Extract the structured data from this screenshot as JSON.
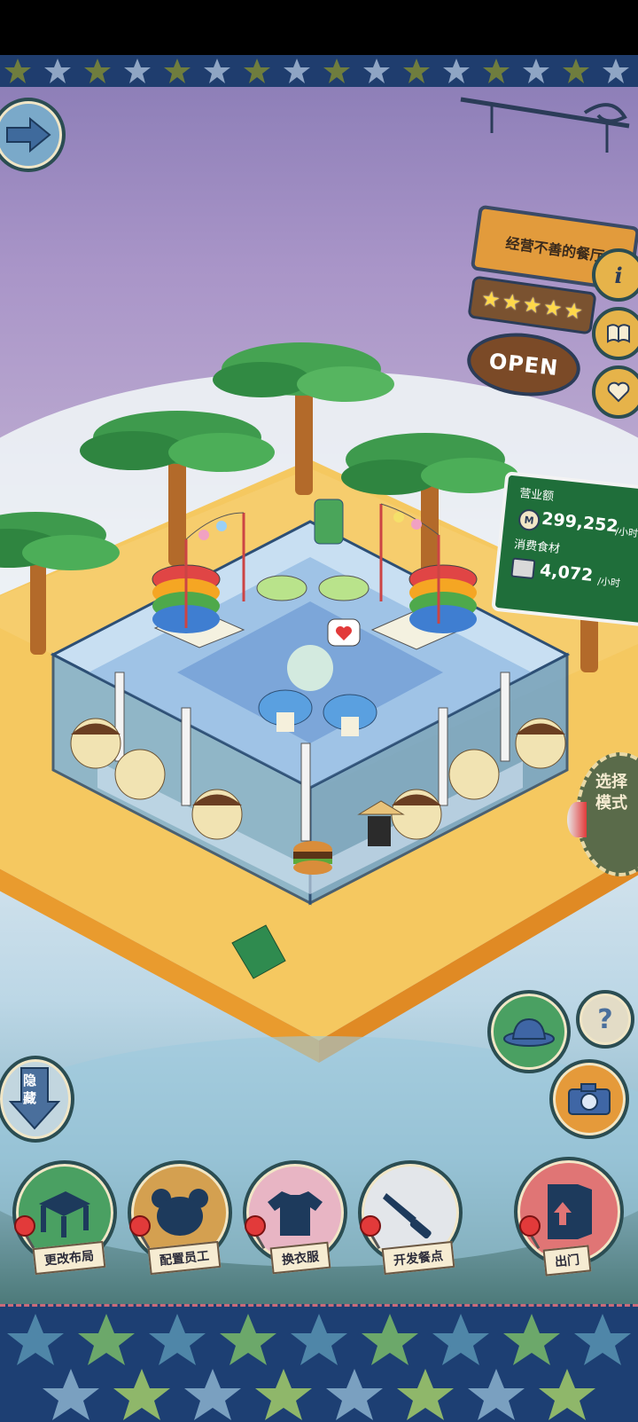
{
  "restaurant": {
    "name": "经营不善的餐厅",
    "rating_stars": 5,
    "status": "OPEN"
  },
  "stats": {
    "revenue_label": "营业额",
    "revenue_value": "299,252",
    "revenue_unit": "/小时",
    "ingredients_label": "消费食材",
    "ingredients_value": "4,072",
    "ingredients_unit": "/小时"
  },
  "side_icons": {
    "info": "i",
    "help": "?"
  },
  "mode_button": "选择\n模式",
  "hide_button": "隐\n藏",
  "menu": [
    {
      "label": "更改布局",
      "icon": "table-icon"
    },
    {
      "label": "配置员工",
      "icon": "bear-head-icon"
    },
    {
      "label": "换衣服",
      "icon": "shirt-icon"
    },
    {
      "label": "开发餐点",
      "icon": "knife-icon"
    },
    {
      "label": "出门",
      "icon": "door-icon"
    }
  ],
  "colors": {
    "accent_green": "#1f6e3a",
    "sign_orange": "#e29b3c",
    "pin_red": "#e23a3a"
  }
}
